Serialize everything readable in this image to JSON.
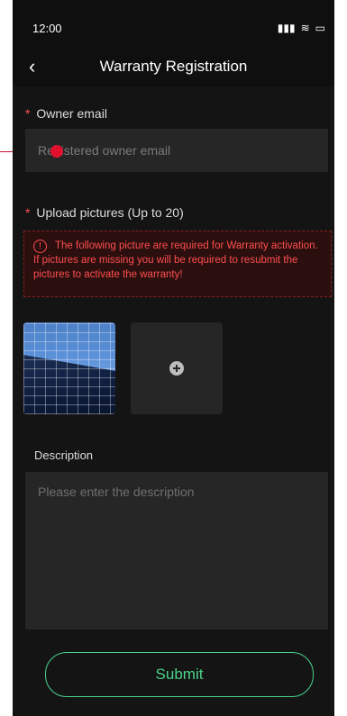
{
  "status_bar": {
    "time": "12:00",
    "signal_icon": "signal-icon",
    "wifi_icon": "wifi-icon",
    "battery_icon": "battery-icon"
  },
  "nav": {
    "title": "Warranty Registration",
    "back_icon": "back-chevron-icon"
  },
  "form": {
    "owner_email": {
      "required_mark": "*",
      "label": "Owner email",
      "placeholder": "Registered owner email"
    },
    "upload": {
      "required_mark": "*",
      "label": "Upload pictures (Up to 20)",
      "warning": "The following picture are required for Warranty activation. If pictures are missing you will be required to resubmit the pictures to activate the warranty!"
    },
    "description": {
      "label": "Description",
      "placeholder": "Please enter the description"
    },
    "submit_label": "Submit"
  },
  "colors": {
    "accent": "#4ad38a",
    "warning": "#ff4d4d",
    "required": "#ff5555"
  }
}
